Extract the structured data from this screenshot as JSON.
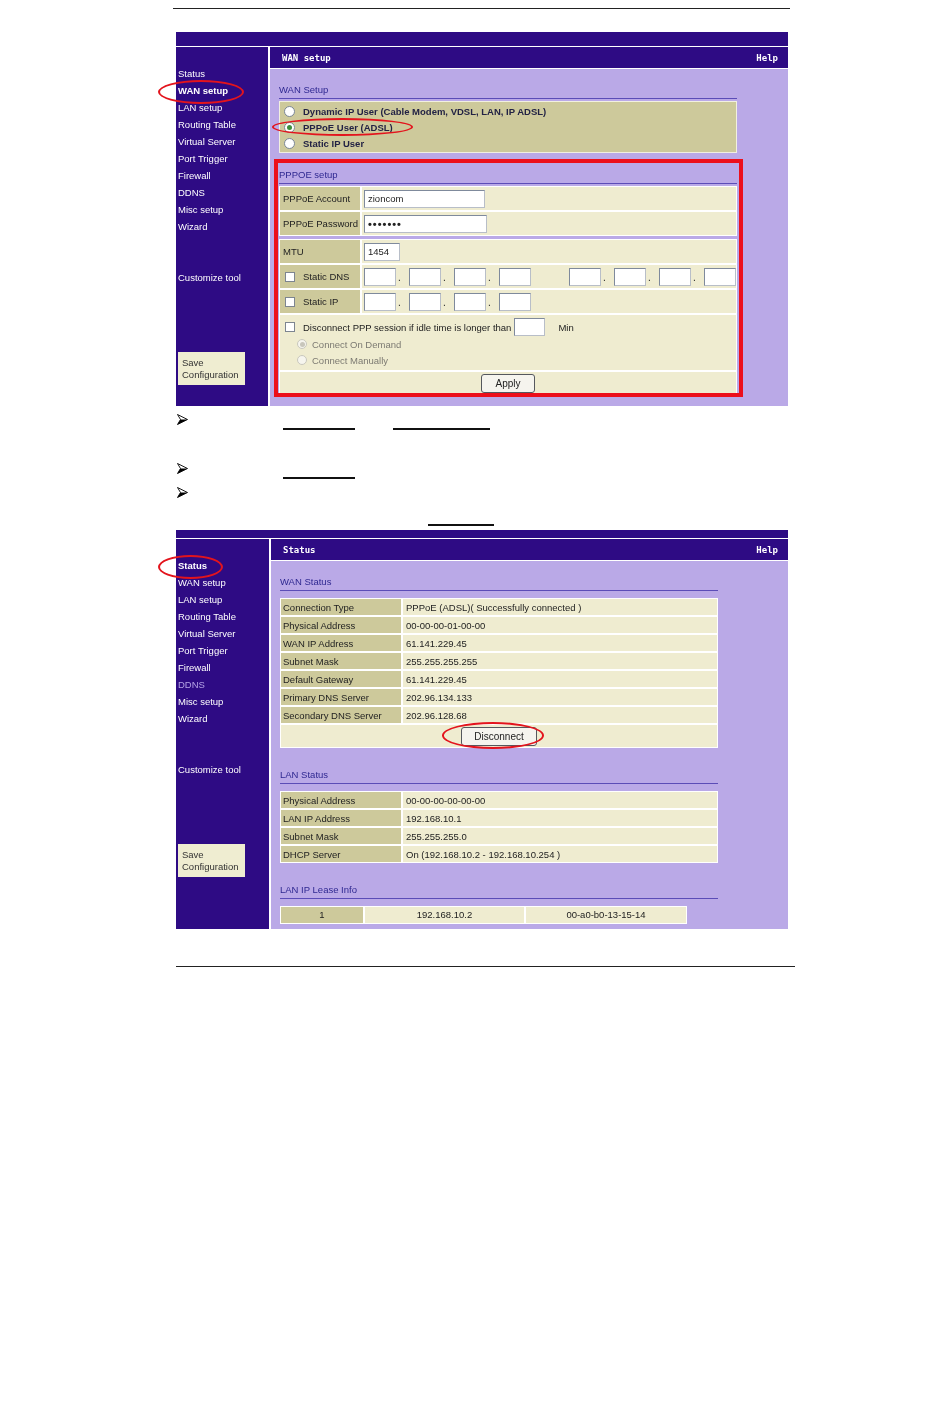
{
  "sections": [
    {
      "kind": "screen",
      "header": {
        "title": "WAN setup",
        "help": "Help"
      },
      "nav": {
        "items": [
          {
            "label": "Status",
            "selected": false,
            "visited": false,
            "highlighted": false
          },
          {
            "label": "WAN setup",
            "selected": true,
            "visited": false,
            "highlighted": true
          },
          {
            "label": "LAN setup",
            "selected": false,
            "visited": false,
            "highlighted": false
          },
          {
            "label": "Routing Table",
            "selected": false,
            "visited": false,
            "highlighted": false
          },
          {
            "label": "Virtual Server",
            "selected": false,
            "visited": false,
            "highlighted": false
          },
          {
            "label": "Port Trigger",
            "selected": false,
            "visited": false,
            "highlighted": false
          },
          {
            "label": "Firewall",
            "selected": false,
            "visited": false,
            "highlighted": false
          },
          {
            "label": "DDNS",
            "selected": false,
            "visited": false,
            "highlighted": false
          },
          {
            "label": "Misc setup",
            "selected": false,
            "visited": false,
            "highlighted": false
          },
          {
            "label": "Wizard",
            "selected": false,
            "visited": false,
            "highlighted": false
          }
        ],
        "tool_label": "Customize tool",
        "save_button": "Save Configuration"
      },
      "panels": [
        {
          "kind": "radio_group",
          "heading": "WAN Setup",
          "options": [
            {
              "label": "Dynamic IP User (Cable Modem, VDSL, LAN, IP ADSL)",
              "selected": false,
              "highlighted": false
            },
            {
              "label": "PPPoE User (ADSL)",
              "selected": true,
              "highlighted": true
            },
            {
              "label": "Static IP User",
              "selected": false,
              "highlighted": false
            }
          ]
        },
        {
          "kind": "form",
          "heading": "PPPOE setup",
          "highlighted": true,
          "groups": [
            {
              "rows": [
                {
                  "kind": "text",
                  "label": "PPPoE Account",
                  "value": "zioncom"
                },
                {
                  "kind": "password",
                  "label": "PPPoE Password",
                  "value": "•••••••"
                }
              ]
            },
            {
              "rows": [
                {
                  "kind": "short",
                  "label": "MTU",
                  "value": "1454"
                },
                {
                  "kind": "ip",
                  "label": "Static DNS",
                  "checked": false,
                  "addresses": [
                    {
                      "separators": [
                        ".",
                        ".",
                        "."
                      ]
                    },
                    {
                      "separators": [
                        ".",
                        ".",
                        "."
                      ]
                    }
                  ]
                },
                {
                  "kind": "ip",
                  "label": "Static IP",
                  "checked": false,
                  "addresses": [
                    {
                      "separators": [
                        ".",
                        ".",
                        "."
                      ]
                    }
                  ]
                },
                {
                  "kind": "idle",
                  "checked": false,
                  "label": "Disconnect PPP session if idle time is longer than",
                  "unit": "Min",
                  "options": [
                    {
                      "label": "Connect On Demand",
                      "selected": true,
                      "disabled": true
                    },
                    {
                      "label": "Connect Manually",
                      "selected": false,
                      "disabled": true
                    }
                  ]
                },
                {
                  "kind": "action",
                  "button": "Apply"
                }
              ]
            }
          ]
        }
      ]
    },
    {
      "kind": "notes",
      "items": [
        {
          "blanks": [
            {
              "kind": "short"
            },
            {
              "kind": "long"
            }
          ]
        },
        {
          "blanks": [
            {
              "kind": "short"
            }
          ]
        },
        {
          "blanks": [
            {
              "kind": "wrapped"
            }
          ]
        }
      ]
    },
    {
      "kind": "screen",
      "header": {
        "title": "Status",
        "help": "Help"
      },
      "nav": {
        "items": [
          {
            "label": "Status",
            "selected": true,
            "visited": false,
            "highlighted": true
          },
          {
            "label": "WAN setup",
            "selected": false,
            "visited": false,
            "highlighted": false
          },
          {
            "label": "LAN setup",
            "selected": false,
            "visited": false,
            "highlighted": false
          },
          {
            "label": "Routing Table",
            "selected": false,
            "visited": false,
            "highlighted": false
          },
          {
            "label": "Virtual Server",
            "selected": false,
            "visited": false,
            "highlighted": false
          },
          {
            "label": "Port Trigger",
            "selected": false,
            "visited": false,
            "highlighted": false
          },
          {
            "label": "Firewall",
            "selected": false,
            "visited": false,
            "highlighted": false
          },
          {
            "label": "DDNS",
            "selected": false,
            "visited": true,
            "highlighted": false
          },
          {
            "label": "Misc setup",
            "selected": false,
            "visited": false,
            "highlighted": false
          },
          {
            "label": "Wizard",
            "selected": false,
            "visited": false,
            "highlighted": false
          }
        ],
        "tool_label": "Customize tool",
        "save_button": "Save Configuration"
      },
      "panels": [
        {
          "kind": "info_table",
          "heading": "WAN Status",
          "rows": [
            {
              "label": "Connection Type",
              "value": "PPPoE (ADSL)( Successfully connected )"
            },
            {
              "label": "Physical Address",
              "value": "00-00-00-01-00-00"
            },
            {
              "label": "WAN IP Address",
              "value": "61.141.229.45"
            },
            {
              "label": "Subnet Mask",
              "value": "255.255.255.255"
            },
            {
              "label": "Default Gateway",
              "value": "61.141.229.45"
            },
            {
              "label": "Primary DNS Server",
              "value": "202.96.134.133"
            },
            {
              "label": "Secondary DNS Server",
              "value": "202.96.128.68"
            }
          ],
          "button": {
            "label": "Disconnect",
            "highlighted": true
          }
        },
        {
          "kind": "info_table",
          "heading": "LAN Status",
          "rows": [
            {
              "label": "Physical Address",
              "value": "00-00-00-00-00-00"
            },
            {
              "label": "LAN IP Address",
              "value": "192.168.10.1"
            },
            {
              "label": "Subnet Mask",
              "value": "255.255.255.0"
            },
            {
              "label": "DHCP Server",
              "value": "On (192.168.10.2 - 192.168.10.254 )"
            }
          ]
        },
        {
          "kind": "lease_table",
          "heading": "LAN IP Lease Info",
          "rows": [
            {
              "cells": [
                "1",
                "192.168.10.2",
                "00-a0-b0-13-15-14"
              ]
            }
          ]
        }
      ]
    }
  ]
}
